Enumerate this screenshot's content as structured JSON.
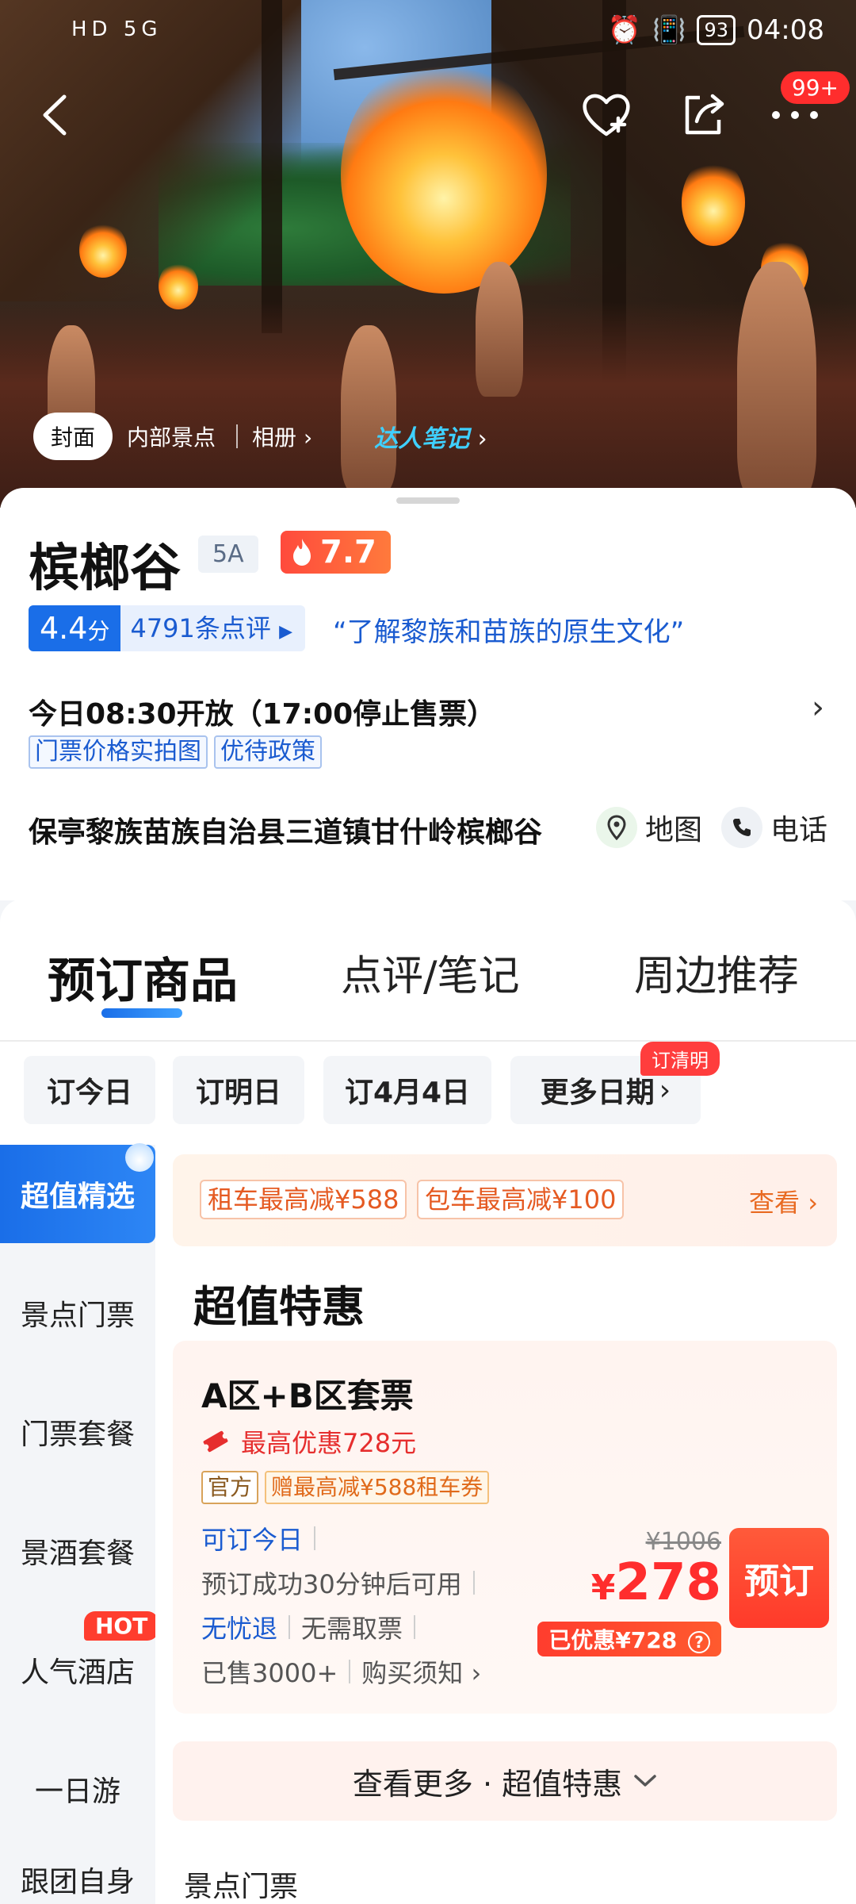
{
  "status_bar": {
    "left": "HD 5G",
    "battery": "93",
    "time": "04:08"
  },
  "nav": {
    "badge": "99+"
  },
  "hero_tabs": {
    "cover": "封面",
    "inner": "内部景点",
    "album": "相册",
    "notes": "达人笔记"
  },
  "info": {
    "title": "槟榔谷",
    "grade": "5A",
    "heat": "7.7",
    "score": "4.4",
    "score_unit": "分",
    "review_count": "4791条点评",
    "quote": "“了解黎族和苗族的原生文化”",
    "hours": "今日08:30开放（17:00停止售票）",
    "tags": [
      "门票价格实拍图",
      "优待政策"
    ],
    "address": "保亭黎族苗族自治县三道镇甘什岭槟榔谷",
    "map_label": "地图",
    "phone_label": "电话"
  },
  "tabs": {
    "booking": "预订商品",
    "reviews": "点评/笔记",
    "nearby": "周边推荐"
  },
  "dates": {
    "today": "订今日",
    "tomorrow": "订明日",
    "apr4": "订4月4日",
    "more": "更多日期",
    "badge": "订清明"
  },
  "sidebar": {
    "items": [
      "超值精选",
      "景点门票",
      "门票套餐",
      "景酒套餐",
      "人气酒店",
      "一日游",
      "跟团自身"
    ],
    "hot": "HOT"
  },
  "promo": {
    "tag1": "租车最高减¥588",
    "tag2": "包车最高减¥100",
    "view": "查看"
  },
  "section_title": "超值特惠",
  "product": {
    "name": "A区+B区套票",
    "discount": "最高优惠728元",
    "tag_official": "官方",
    "tag_gift": "赠最高减¥588租车券",
    "today": "可订今日",
    "usable": "预订成功30分钟后可用",
    "refund": "无忧退",
    "no_ticket": "无需取票",
    "sold": "已售3000+",
    "notice": "购买须知",
    "old_price": "¥1006",
    "price_symbol": "¥",
    "price": "278",
    "saved": "已优惠¥728",
    "book": "预订"
  },
  "more": {
    "label": "查看更多 · 超值特惠"
  },
  "next_section": "景点门票",
  "colors": {
    "brand_blue": "#1a6ee8",
    "price_red": "#ff2d2d",
    "promo_orange": "#e86a22"
  }
}
